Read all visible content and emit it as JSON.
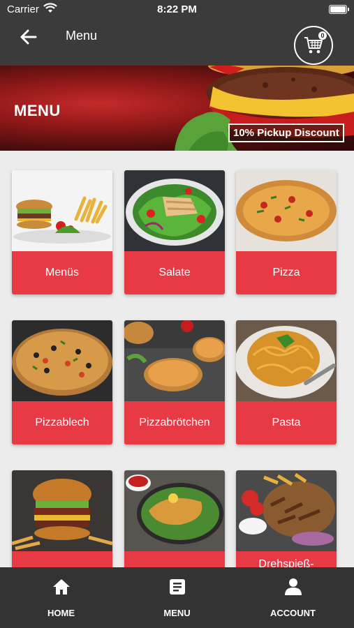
{
  "status_bar": {
    "carrier": "Carrier",
    "time": "8:22 PM"
  },
  "header": {
    "title": "Menu",
    "cart_count": "0"
  },
  "hero": {
    "title": "MENU",
    "discount": "10% Pickup Discount"
  },
  "categories": [
    {
      "label": "Menüs"
    },
    {
      "label": "Salate"
    },
    {
      "label": "Pizza"
    },
    {
      "label": "Pizzablech"
    },
    {
      "label": "Pizzabrötchen"
    },
    {
      "label": "Pasta"
    },
    {
      "label": ""
    },
    {
      "label": ""
    },
    {
      "label": "Drehspieß-"
    }
  ],
  "tabs": [
    {
      "label": "HOME",
      "icon": "home-icon"
    },
    {
      "label": "MENU",
      "icon": "menu-list-icon"
    },
    {
      "label": "ACCOUNT",
      "icon": "account-icon"
    }
  ],
  "colors": {
    "accent": "#e83a44",
    "bar": "#3b3b3b",
    "tabbar": "#333333"
  }
}
